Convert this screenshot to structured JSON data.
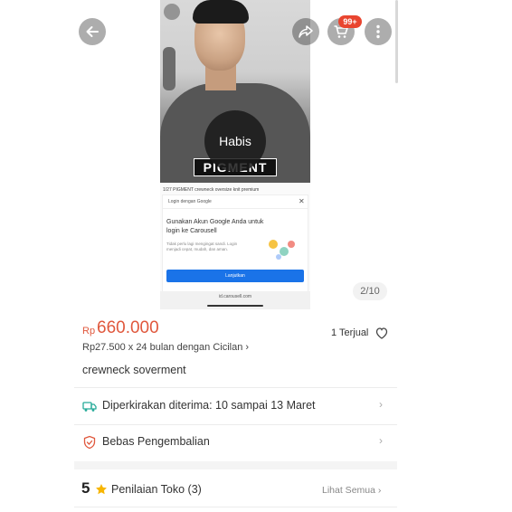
{
  "gallery": {
    "sold_overlay": "Habis",
    "brand_text": "PIGMENT",
    "caption": "1/27 PIGMENT crewneck oversize knit premium",
    "google_card": {
      "header": "Login dengan Google",
      "title": "Gunakan Akun Google Anda untuk login ke Carousell",
      "subtitle": "Tidak perlu lagi mengingat sandi. Login menjadi cepat, mudah, dan aman.",
      "button": "Lanjutkan"
    },
    "url": "id.carousell.com",
    "counter": "2/10"
  },
  "header": {
    "cart_badge": "99+"
  },
  "product": {
    "currency": "Rp",
    "price": "660.000",
    "sold": "1 Terjual",
    "installment": "Rp27.500 x 24 bulan dengan Cicilan",
    "title": "crewneck soverment"
  },
  "rows": {
    "delivery": "Diperkirakan diterima: 10 sampai 13 Maret",
    "return": "Bebas Pengembalian"
  },
  "rating": {
    "score": "5",
    "label": "Penilaian Toko (3)",
    "see_all": "Lihat Semua"
  },
  "colors": {
    "accent": "#e0583d",
    "badge": "#e9452f",
    "delivery_icon": "#26aa99",
    "return_icon": "#e0583d",
    "star": "#f7b500"
  },
  "icons": [
    "back-arrow-icon",
    "share-icon",
    "cart-icon",
    "more-vertical-icon",
    "heart-icon",
    "truck-icon",
    "shield-icon",
    "chevron-right-icon",
    "star-icon"
  ]
}
